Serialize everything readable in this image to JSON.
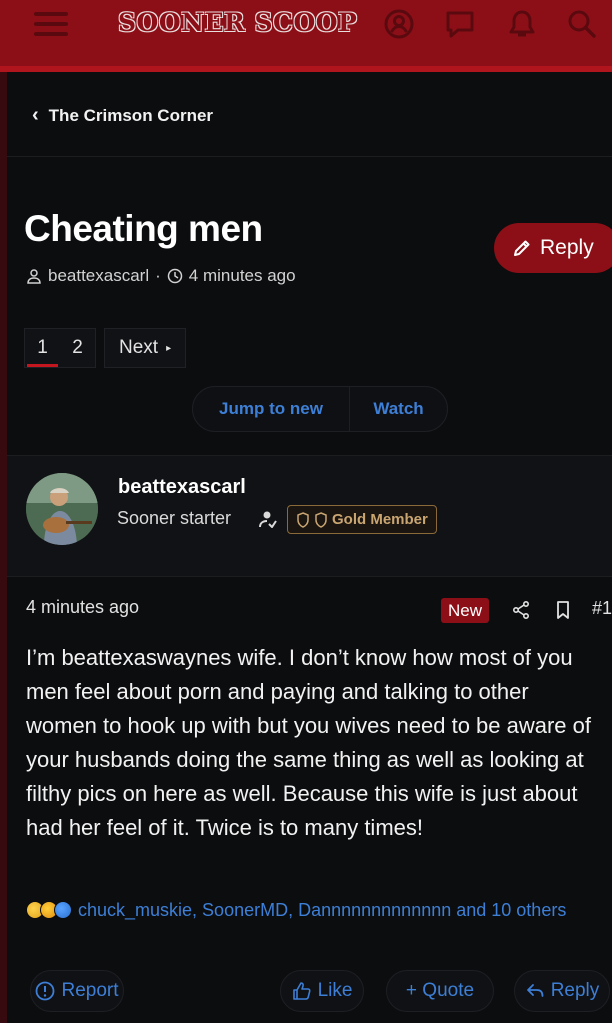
{
  "header": {
    "logo_text": "SOONER SCOOP",
    "icons": [
      "menu-icon",
      "account-icon",
      "messages-icon",
      "alerts-icon",
      "search-icon"
    ],
    "brand_color": "#8c0f17"
  },
  "breadcrumb": {
    "label": "The Crimson Corner"
  },
  "thread": {
    "title": "Cheating men",
    "reply_label": "Reply",
    "author": "beattexascarl",
    "separator": "·",
    "time": "4 minutes ago"
  },
  "pagination": {
    "pages": [
      "1",
      "2"
    ],
    "current": "1",
    "next_label": "Next",
    "next_arrow": "▸"
  },
  "thread_actions": {
    "jump_label": "Jump to new",
    "watch_label": "Watch"
  },
  "post": {
    "username": "beattexascarl",
    "user_title": "Sooner starter",
    "badge": "Gold Member",
    "time": "4 minutes ago",
    "new_label": "New",
    "number": "#1",
    "body": "I’m beattexaswaynes wife. I don’t know how most of you men feel about porn and paying and talking to other women to hook up with but you wives need to be aware of your husbands doing the same thing as well as looking at filthy pics on here as well. Because this wife is just about had her feel of it. Twice is to many times!",
    "reactions_text": "chuck_muskie, SoonerMD, Dannnnnnnnnnnnn and 10 others",
    "actions": {
      "report": "Report",
      "like": "Like",
      "quote": "+ Quote",
      "reply": "Reply"
    }
  },
  "colors": {
    "link": "#3d7fd6",
    "accent": "#c4161f",
    "badge_gold": "#c9a572"
  }
}
